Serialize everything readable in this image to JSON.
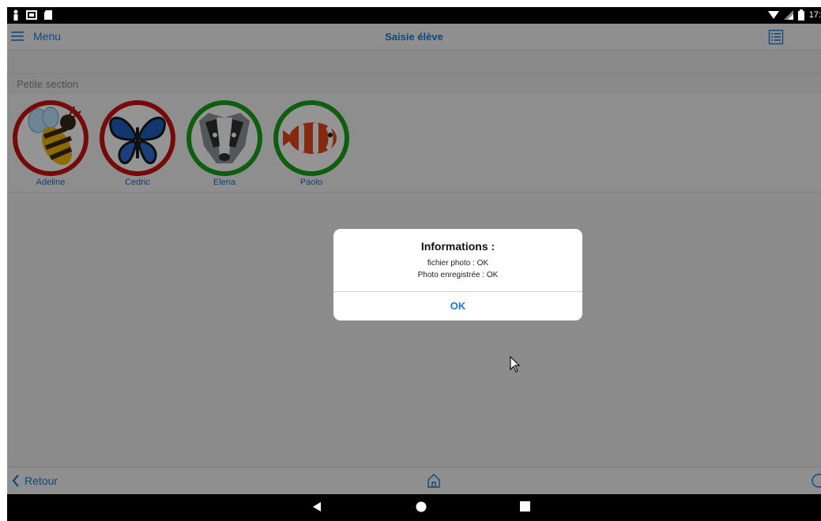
{
  "status_bar": {
    "time": "17:",
    "icons": [
      "person-notification-icon",
      "gallery-icon",
      "sd-card-icon",
      "wifi-icon",
      "signal-icon",
      "battery-icon"
    ]
  },
  "header": {
    "menu_label": "Menu",
    "title": "Saisie élève"
  },
  "section": {
    "title": "Petite section"
  },
  "students": [
    {
      "name": "Adeline",
      "ring_color": "#cc1111",
      "avatar": "bee-icon"
    },
    {
      "name": "Cedric",
      "ring_color": "#cc1111",
      "avatar": "butterfly-icon"
    },
    {
      "name": "Elena",
      "ring_color": "#1aa01a",
      "avatar": "badger-icon"
    },
    {
      "name": "Paolo",
      "ring_color": "#1aa01a",
      "avatar": "clownfish-icon"
    }
  ],
  "bottom_bar": {
    "back_label": "Retour"
  },
  "dialog": {
    "title": "Informations :",
    "lines": [
      "fichier photo : OK",
      "Photo enregistrée : OK"
    ],
    "button_label": "OK"
  },
  "colors": {
    "accent": "#1a7ad9",
    "ring_red": "#cc1111",
    "ring_green": "#1aa01a"
  }
}
